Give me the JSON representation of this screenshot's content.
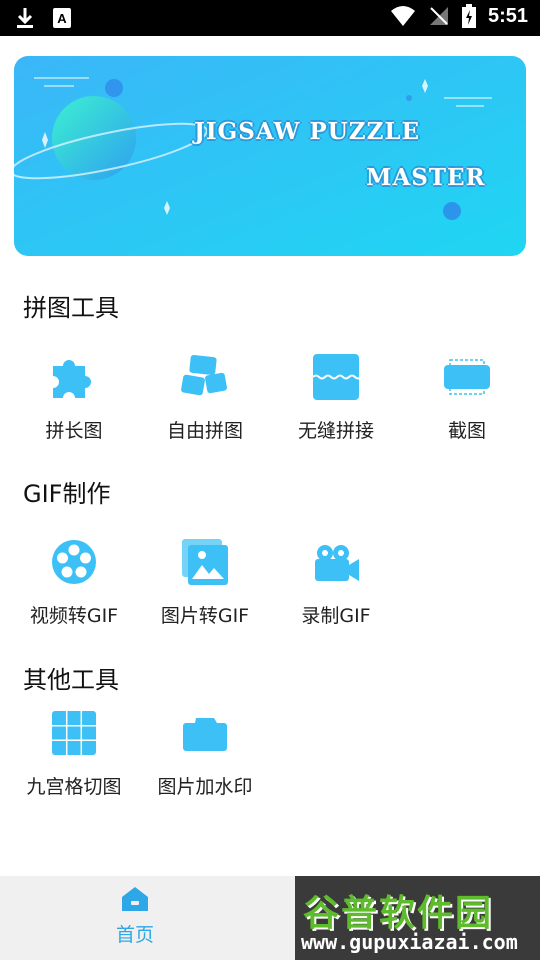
{
  "status_bar": {
    "time": "5:51",
    "icons": [
      "download-icon",
      "a-icon",
      "wifi-icon",
      "no-signal-icon",
      "battery-charging-icon"
    ]
  },
  "banner": {
    "title_line1": "JIGSAW PUZZLE",
    "title_line2": "MASTER"
  },
  "sections": [
    {
      "title": "拼图工具",
      "items": [
        {
          "label": "拼长图",
          "icon": "puzzle-piece-icon"
        },
        {
          "label": "自由拼图",
          "icon": "free-collage-icon"
        },
        {
          "label": "无缝拼接",
          "icon": "seamless-stitch-icon"
        },
        {
          "label": "截图",
          "icon": "screenshot-icon"
        }
      ]
    },
    {
      "title": "GIF制作",
      "items": [
        {
          "label": "视频转GIF",
          "icon": "film-reel-icon"
        },
        {
          "label": "图片转GIF",
          "icon": "images-icon"
        },
        {
          "label": "录制GIF",
          "icon": "video-camera-icon"
        }
      ]
    },
    {
      "title": "其他工具",
      "items": [
        {
          "label": "九宫格切图",
          "icon": "grid-icon"
        },
        {
          "label": "图片加水印",
          "icon": "camera-icon"
        }
      ]
    }
  ],
  "bottom_nav": {
    "home_label": "首页",
    "home_icon": "home-icon"
  },
  "watermark": {
    "text": "谷普软件园",
    "url": "www.gupuxiazai.com"
  },
  "colors": {
    "accent": "#2ea7e8",
    "icon_blue": "#3cc0f5",
    "banner_start": "#3bb6f8",
    "banner_end": "#1fd6f2"
  }
}
